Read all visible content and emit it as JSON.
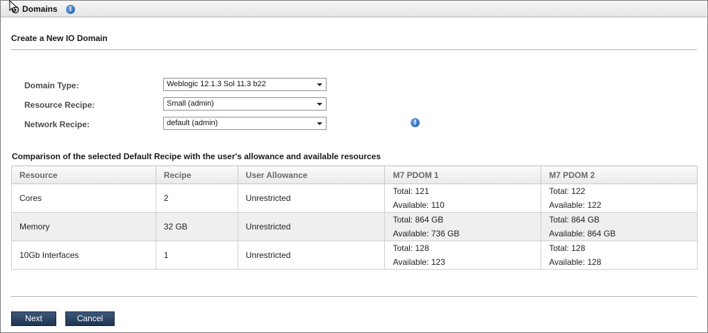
{
  "window": {
    "title": "Domains",
    "info_glyph": "!"
  },
  "page": {
    "section_title": "Create a New IO Domain"
  },
  "form": {
    "domain_type": {
      "label": "Domain Type:",
      "value": "Weblogic 12.1.3 Sol 11.3 b22"
    },
    "resource_recipe": {
      "label": "Resource Recipe:",
      "value": "Small (admin)"
    },
    "network_recipe": {
      "label": "Network Recipe:",
      "value": "default (admin)"
    }
  },
  "comparison": {
    "title": "Comparison of the selected Default Recipe with the user's allowance and available resources",
    "headers": [
      "Resource",
      "Recipe",
      "User Allowance",
      "M7 PDOM 1",
      "M7 PDOM 2"
    ],
    "rows": [
      {
        "resource": "Cores",
        "recipe": "2",
        "allowance": "Unrestricted",
        "pdom1_total": "Total: 121",
        "pdom1_available": "Available: 110",
        "pdom2_total": "Total: 122",
        "pdom2_available": "Available: 122"
      },
      {
        "resource": "Memory",
        "recipe": "32 GB",
        "allowance": "Unrestricted",
        "pdom1_total": "Total: 864 GB",
        "pdom1_available": "Available: 736 GB",
        "pdom2_total": "Total: 864 GB",
        "pdom2_available": "Available: 864 GB"
      },
      {
        "resource": "10Gb Interfaces",
        "recipe": "1",
        "allowance": "Unrestricted",
        "pdom1_total": "Total: 128",
        "pdom1_available": "Available: 123",
        "pdom2_total": "Total: 128",
        "pdom2_available": "Available: 128"
      }
    ]
  },
  "buttons": {
    "next": "Next",
    "cancel": "Cancel"
  },
  "colors": {
    "button_bg": "#2b4364",
    "info_blue": "#1f5aa6",
    "header_text": "#6b6b6b"
  },
  "icons": {
    "title_icon": "domains-gear-icon",
    "info_icon": "info-icon",
    "dropdown_icon": "chevron-down-icon"
  }
}
